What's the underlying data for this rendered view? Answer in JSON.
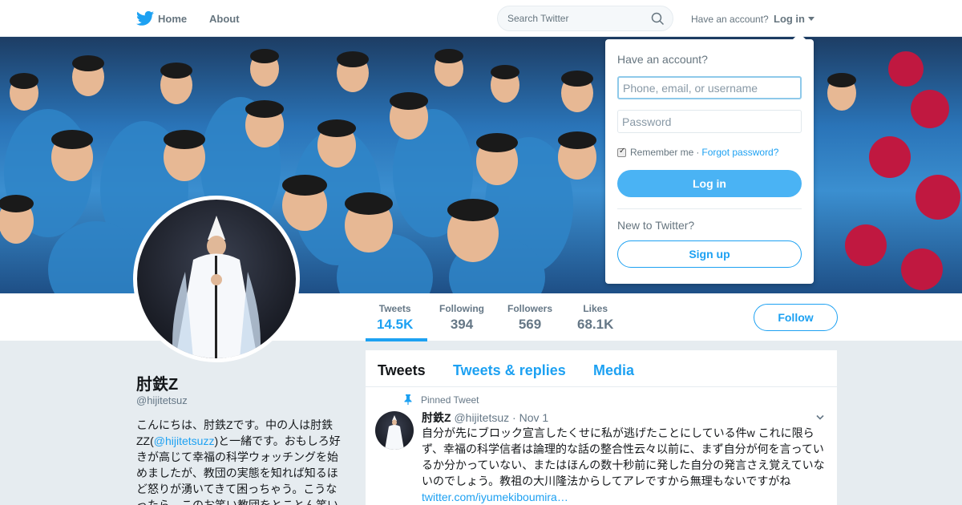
{
  "nav": {
    "home_label": "Home",
    "about_label": "About",
    "search_placeholder": "Search Twitter",
    "have_account": "Have an account?",
    "login_label": "Log in"
  },
  "profile": {
    "name": "肘鉄Z",
    "handle": "@hijitetsuz",
    "bio_part1": "こんにちは、肘鉄Zです。中の人は肘鉄ZZ(",
    "bio_link": "@hijitetsuzz",
    "bio_part2": ")と一緒です。おもしろ好きが高じて幸福の科学ウォッチングを始めましたが、教団の実態を知れば知るほど怒りが湧いてきて困っちゃう。こうなったら、このお笑い教団をとことん笑い",
    "follow_label": "Follow"
  },
  "stats": [
    {
      "label": "Tweets",
      "value": "14.5K"
    },
    {
      "label": "Following",
      "value": "394"
    },
    {
      "label": "Followers",
      "value": "569"
    },
    {
      "label": "Likes",
      "value": "68.1K"
    }
  ],
  "timeline": {
    "tabs": [
      "Tweets",
      "Tweets & replies",
      "Media"
    ],
    "pinned_label": "Pinned Tweet",
    "tweet": {
      "name": "肘鉄Z",
      "handle": "@hijitetsuz",
      "time": "· Nov 1",
      "text": "自分が先にブロック宣言したくせに私が逃げたことにしている件w これに限らず、幸福の科学信者は論理的な話の整合性云々以前に、まず自分が何を言っているか分かっていない、またはほんの数十秒前に発した自分の発言さえ覚えていないのでしょう。教祖の大川隆法からしてアレですから無理もないですがね",
      "link": "twitter.com/iyumekiboumira…"
    }
  },
  "login_dropdown": {
    "title": "Have an account?",
    "username_placeholder": "Phone, email, or username",
    "password_placeholder": "Password",
    "remember_label": "Remember me",
    "forgot_label": "Forgot password?",
    "login_button": "Log in",
    "new_label": "New to Twitter?",
    "signup_button": "Sign up"
  },
  "colors": {
    "accent": "#1da1f2",
    "login_button": "#4ab3f4",
    "background": "#e6ecf0"
  }
}
